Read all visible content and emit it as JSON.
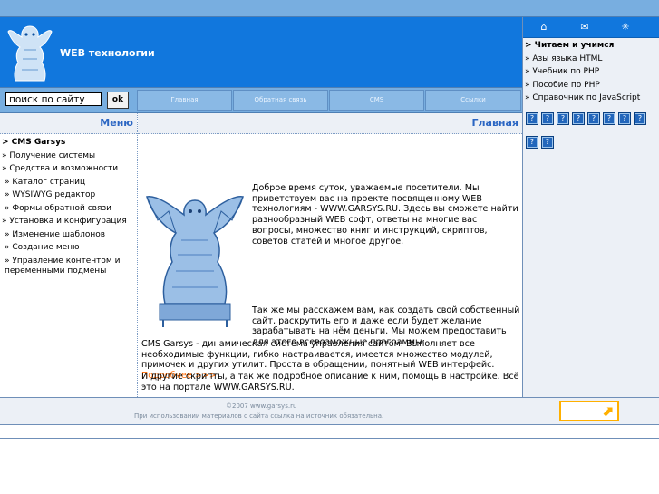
{
  "header": {
    "site_title": "WEB технологии"
  },
  "search": {
    "placeholder": "поиск по сайту",
    "button_label": "ok"
  },
  "nav": {
    "items": [
      "Главная",
      "Обратная связь",
      "CMS",
      "Ссылки"
    ]
  },
  "left_menu": {
    "title": "Меню",
    "items": [
      "> CMS Garsys",
      " » Получение системы",
      " » Средства и возможности",
      "   » Каталог страниц",
      "   » WYSIWYG редактор",
      "   » Формы обратной связи",
      " » Установка и конфигурация",
      "   » Изменение шаблонов",
      "   » Создание меню",
      "   » Управление контентом и переменными подмены"
    ]
  },
  "right_menu": {
    "icons": [
      "home-icon",
      "mail-icon",
      "sitemap-icon"
    ],
    "items": [
      "> Читаем и учимся",
      " » Азы языка HTML",
      " » Учебник по PHP",
      " » Пособие по PHP",
      " » Справочник по JavaScript"
    ],
    "buttons": [
      "?",
      "?",
      "?",
      "?",
      "?",
      "?",
      "?",
      "?",
      "?",
      "?"
    ]
  },
  "content": {
    "title": "Главная",
    "p1": "Доброе время суток, уважаемые посетители. Мы приветствуем вас на проекте посвященному WEB технологиям - WWW.GARSYS.RU. Здесь вы сможете найти разнообразный WEB софт, ответы на многие вас вопросы, множество книг и инструкций, скриптов, советов статей и многое другое.",
    "p2": "Так же мы расскажем вам, как создать свой собственный сайт, раскрутить его и даже если будет желание зарабатывать на нём деньги. Мы можем предоставить для этого всевозможные программы:",
    "p3": "CMS Garsys - динамическая система управления сайтом. Выполняет все необходимые функции, гибко настраивается, имеется множество модулей, примочек и других утилит. Проста в обращении, понятный WEB интерфейс.",
    "more_link": "Подробнее >>>",
    "p4": "И другие скрипты, а так же подробное описание к ним, помощь в настройке. Всё это на портале WWW.GARSYS.RU."
  },
  "footer": {
    "line1": "©2007 www.garsys.ru",
    "line2": "При использовании материалов с сайта ссылка на источник обязательна."
  },
  "colors": {
    "header_blue": "#1177dd",
    "nav_blue": "#78aee0",
    "panel_bg": "#ecf0f6",
    "title_blue": "#2b66c3",
    "link_orange": "#ff6a00",
    "counter_orange": "#ffb000"
  }
}
